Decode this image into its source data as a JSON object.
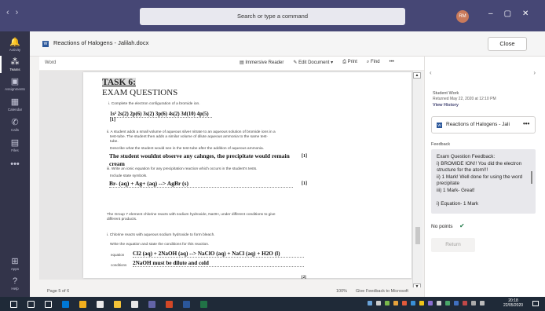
{
  "titlebar": {
    "back_glyph": "‹",
    "forward_glyph": "›",
    "search_placeholder": "Search or type a command",
    "avatar_initials": "RM",
    "minimize_glyph": "–",
    "restore_glyph": "▢",
    "close_glyph": "✕"
  },
  "rail": {
    "items": [
      {
        "label": "Activity",
        "icon": "bell-icon",
        "glyph": "🔔"
      },
      {
        "label": "Teams",
        "icon": "teams-icon",
        "glyph": "⁂"
      },
      {
        "label": "Assignments",
        "icon": "assignments-icon",
        "glyph": "▣"
      },
      {
        "label": "Calendar",
        "icon": "calendar-icon",
        "glyph": "▦"
      },
      {
        "label": "Calls",
        "icon": "phone-icon",
        "glyph": "✆"
      },
      {
        "label": "Files",
        "icon": "file-icon",
        "glyph": "▤"
      },
      {
        "label": "",
        "icon": "more-icon",
        "glyph": "•••"
      },
      {
        "label": "Apps",
        "icon": "apps-icon",
        "glyph": "⊞"
      },
      {
        "label": "Help",
        "icon": "help-icon",
        "glyph": "?"
      }
    ]
  },
  "doc": {
    "title": "Reactions of Halogens - Jalilah.docx",
    "close_label": "Close",
    "word_label": "Word",
    "toolbar": {
      "immersive": "Immersive Reader",
      "edit": "Edit Document ▾",
      "print": "Print",
      "find": "Find",
      "more": "•••"
    },
    "page_number": "Page 5 of 6",
    "zoom": "100%",
    "give_feedback": "Give Feedback to Microsoft"
  },
  "page": {
    "task": "TASK 6:",
    "exam": "EXAM QUESTIONS",
    "q1": "i. Complete the electron configuration of a bromide ion.",
    "a1": "1s² 2s(2) 2p(6) 3s(2) 3p(6) 4s(2) 3d(10) 4p(5)",
    "m1": "[1]",
    "q2a": "ii. A student adds a small volume of aqueous silver nitrate to an aqueous solution of bromide ions in a",
    "q2b": "test-tube. The student then adds a similar volume of dilute aqueous ammonia to the same test-",
    "q2c": "tube.",
    "q2d": "Describe what the student would see in the test-tube after the addition of aqueous ammonia.",
    "a2a": "The student wouldnt observe any cahnges, the precipitate would remain",
    "a2b": "cream",
    "m2": "[1]",
    "q3": "iii. Write an ionic equation for any precipitation reaction which occurs in the student's tests.",
    "q3b": "Include state symbols.",
    "a3": "Br- (aq) + Ag+ (aq) --> AgBr (s)",
    "m3": "[1]",
    "intro_a": "The Group 7 element chlorine reacts with sodium hydroxide, NaOH, under different conditions to give",
    "intro_b": "different products.",
    "q4": "i. Chlorine reacts with aqueous sodium hydroxide to form bleach.",
    "q4b": "Write the equation and state the conditions for this reaction.",
    "eq_label": "equation",
    "a4": "Cl2 (aq) + 2NaOH (aq) --> NaClO (aq) + NaCl (aq) + H2O (l)",
    "cond_label": "conditions",
    "a5": "2NaOH must be dilute and cold",
    "m4": "[2]"
  },
  "side": {
    "student_work": "Student Work",
    "returned": "Returned May 22, 2020 at 12:10 PM",
    "view_history": "View History",
    "attachment": "Reactions of Halogens - Jali",
    "attachment_more": "•••",
    "feedback_label": "Feedback",
    "feedback_text": "Exam Question Feedback:\ni) BROMIDE ION!! You did the electron structure for the atom!!!\nii) 1 Mark! Well done for using the word precipitate\niii) 1 Mark- Great!\n\ni) Equation- 1 Mark",
    "points": "No points",
    "return_label": "Return"
  },
  "taskbar": {
    "time": "20:18",
    "date": "22/05/2020",
    "apps": [
      {
        "icon": "windows-start-icon",
        "color": "#ffffff"
      },
      {
        "icon": "search-icon",
        "color": "#ffffff"
      },
      {
        "icon": "task-view-icon",
        "color": "#ffffff"
      },
      {
        "icon": "outlook-icon",
        "color": "#0078d4"
      },
      {
        "icon": "chrome-icon",
        "color": "#f2b01e"
      },
      {
        "icon": "store-icon",
        "color": "#eaeaea"
      },
      {
        "icon": "explorer-icon",
        "color": "#f3c338"
      },
      {
        "icon": "sticky-notes-icon",
        "color": "#e8e8e8"
      },
      {
        "icon": "teams-icon",
        "color": "#6264a7"
      },
      {
        "icon": "powerpoint-icon",
        "color": "#d24726"
      },
      {
        "icon": "word-icon",
        "color": "#2b579a"
      },
      {
        "icon": "excel-icon",
        "color": "#217346"
      }
    ]
  }
}
